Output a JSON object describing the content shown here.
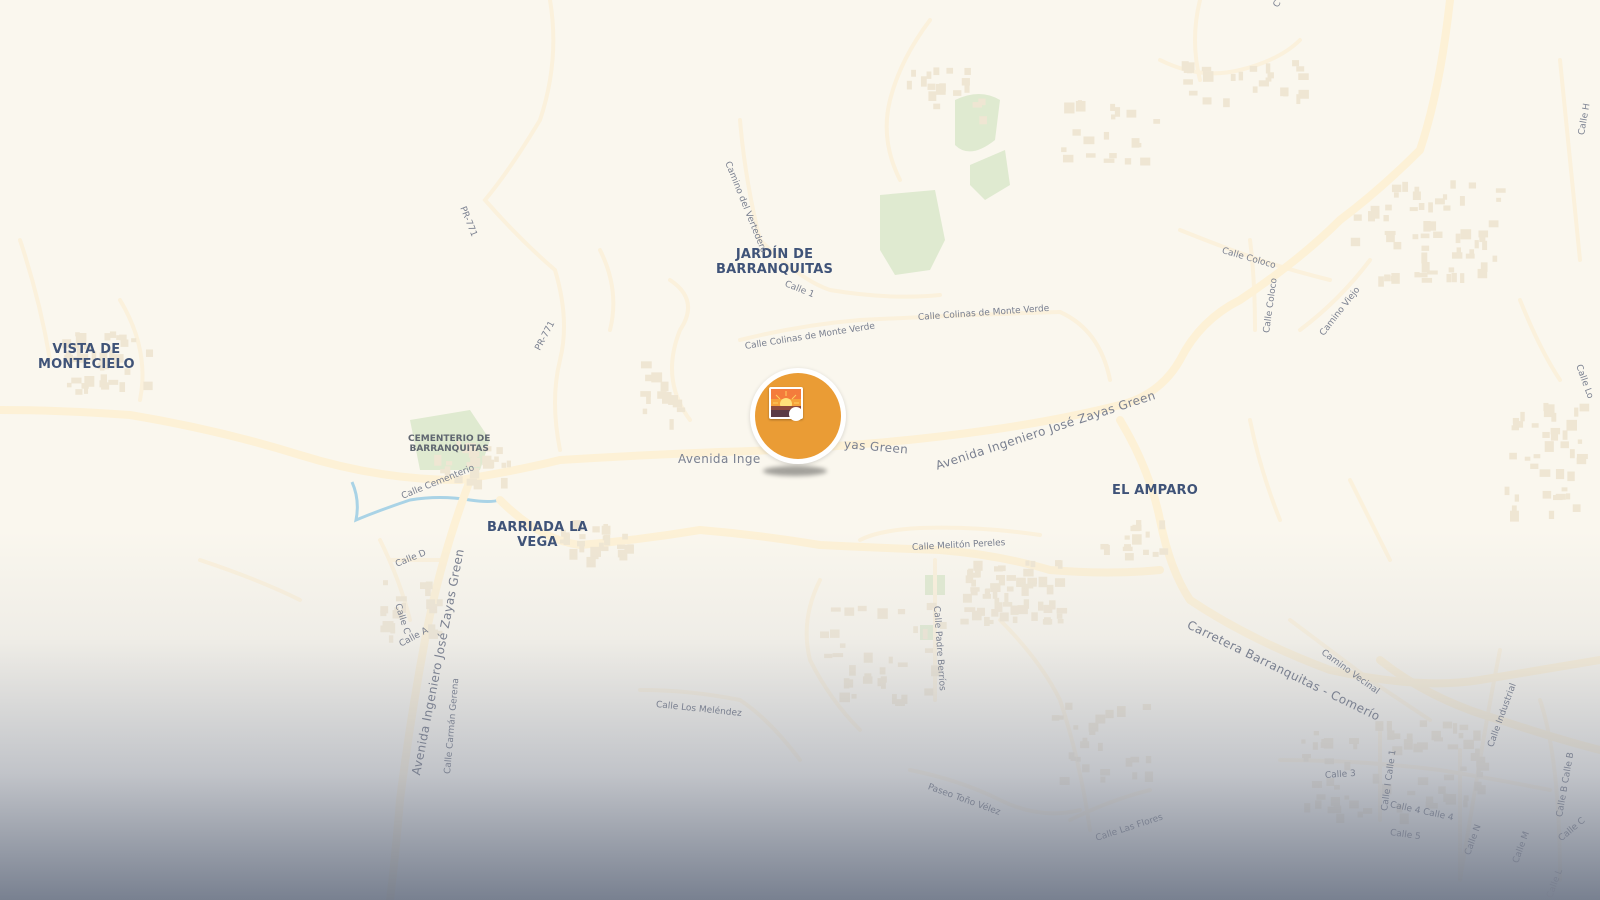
{
  "map": {
    "places": {
      "vista_de_montecielo": "VISTA DE\nMONTECIELO",
      "jardin_de_barranquitas": "JARDÍN DE\nBARRANQUITAS",
      "barriada_la_vega": "BARRIADA LA\nVEGA",
      "el_amparo": "EL AMPARO"
    },
    "pois": {
      "cementerio": "CEMENTERIO DE\nBARRANQUITAS"
    },
    "roads": {
      "pr771_a": "PR-771",
      "pr771_b": "PR-771",
      "camino_del_vertedero": "Camino del Vertedero",
      "calle_1": "Calle 1",
      "calle_colinas_1": "Calle Colinas de Monte Verde",
      "calle_colinas_2": "Calle Colinas de Monte Verde",
      "avenida_inge": "Avenida Inge",
      "yas_green": "yas Green",
      "avenida_main": "Avenida Ingeniero José Zayas Green",
      "avenida_south": "Avenida Ingeniero José Zayas Green",
      "calle_cementerio": "Calle Cementerio",
      "calle_d": "Calle D",
      "calle_c": "Calle C",
      "calle_a": "Calle A",
      "calle_carmen_gerena": "Calle Carmán Gerena",
      "calle_meliton": "Calle Melitón Pereles",
      "calle_padre_berrios": "Calle Padre Berríos",
      "calle_los_melendez": "Calle Los Meléndez",
      "paseo_tono_velez": "Paseo Toño Vélez",
      "calle_las_flores": "Calle Las Flores",
      "carretera": "Carretera Barranquitas - Comerío",
      "camino_vecinal": "Camino Vecinal",
      "calle_coloco_1": "Calle Coloco",
      "calle_coloco_2": "Calle Coloco",
      "camino_viejo": "Camino Viejo",
      "calle_industrial": "Calle Industrial",
      "calle_3": "Calle 3",
      "calle_i_calle_1": "Calle I Calle 1",
      "calle_4": "Calle 4 Calle 4",
      "calle_5": "Calle 5",
      "calle_n": "Calle N",
      "calle_m": "Calle M",
      "calle_b": "Calle B Calle B",
      "calle_c_right": "Calle C",
      "calle_l": "Calle L",
      "calle_h": "Calle H",
      "calle_lo": "Calle Lo",
      "calle_top": "C"
    },
    "marker": {
      "icon": "photo-sunset-icon",
      "color": "#ea9c35"
    },
    "colors": {
      "land": "#faf7ee",
      "road": "#fdf3d9",
      "building": "#efe6d2",
      "park": "#dbe8cc",
      "water": "#a9d3e6",
      "place_label": "#3f5378"
    }
  }
}
